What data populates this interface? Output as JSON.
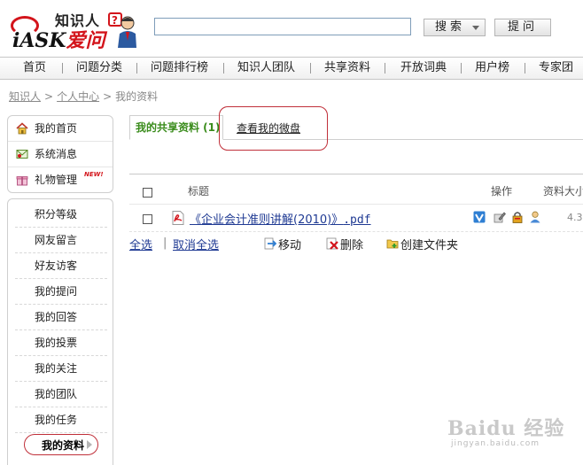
{
  "header": {
    "logo_text_top": "知识人",
    "logo_text_brand": "iASK",
    "logo_text_brand_red": "爱问",
    "search_value": "",
    "search_button": "搜索",
    "ask_button": "提问"
  },
  "nav": {
    "items": [
      "首页",
      "问题分类",
      "问题排行榜",
      "知识人团队",
      "共享资料",
      "开放词典",
      "用户榜",
      "专家团"
    ]
  },
  "breadcrumb": [
    "知识人",
    "个人中心",
    "我的资料"
  ],
  "breadcrumb_sep": ">",
  "sidebar": {
    "top_items": [
      "我的首页",
      "系统消息",
      "礼物管理"
    ],
    "new_badge": "NEW!",
    "items": [
      "积分等级",
      "网友留言",
      "好友访客",
      "我的提问",
      "我的回答",
      "我的投票",
      "我的关注",
      "我的团队",
      "我的任务",
      "我的资料"
    ]
  },
  "tabs": {
    "share": "我的共享资料 (1)",
    "disk": "查看我的微盘"
  },
  "table": {
    "headers": {
      "title": "标题",
      "ops": "操作",
      "size": "资料大小"
    },
    "rows": [
      {
        "title_cn": "《企业会计准则讲解(2010)》",
        "title_ext": ".pdf",
        "size": "4.3"
      }
    ]
  },
  "actions": {
    "select_all": "全选",
    "separator": "|",
    "deselect_all": "取消全选",
    "move": "移动",
    "delete": "删除",
    "new_folder": "创建文件夹"
  },
  "watermark": {
    "main": "Baidu 经验",
    "sub": "jingyan.baidu.com"
  },
  "colors": {
    "accent_green": "#3a8c1c",
    "link_blue": "#1f3a93",
    "highlight_red": "#c0303a",
    "brand_red": "#d3141b"
  }
}
